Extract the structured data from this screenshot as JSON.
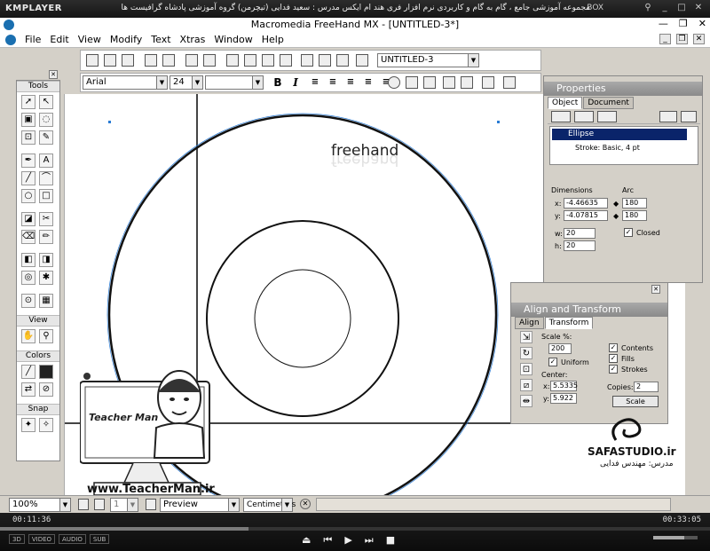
{
  "player": {
    "logo": "KMPLAYER",
    "title": "مجموعه آموزشی جامع ، گام به گام و کاربردی نرم افزار فری هند ام ایکس    مدرس : سعید فدایی (تیچرمن) گروه آموزشی پادشاه گرافیست ها",
    "box": "BOX",
    "time_elapsed": "00:11:36",
    "time_total": "00:33:05",
    "progress": 0.35,
    "volume": 0.7,
    "mini_buttons": [
      "3D",
      "VIDEO",
      "AUDIO",
      "SUB"
    ],
    "icons": [
      "pin-icon",
      "minimize-icon",
      "maximize-icon",
      "close-icon"
    ]
  },
  "app": {
    "title": "Macromedia FreeHand MX - [UNTITLED-3*]",
    "menus": [
      "File",
      "Edit",
      "View",
      "Modify",
      "Text",
      "Xtras",
      "Window",
      "Help"
    ],
    "document_dropdown": "UNTITLED-3",
    "font": "Arial",
    "font_size": "24"
  },
  "tools": {
    "title": "Tools",
    "view_title": "View",
    "colors_title": "Colors",
    "snap_title": "Snap"
  },
  "canvas": {
    "text": "freehand"
  },
  "properties": {
    "title": "Properties",
    "tabs": [
      "Object",
      "Document"
    ],
    "list": [
      "Ellipse",
      "Stroke: Basic, 4 pt"
    ],
    "dimensions_label": "Dimensions",
    "arc_label": "Arc",
    "x_label": "x:",
    "x_value": "-4.46635",
    "y_label": "y:",
    "y_value": "-4.07815",
    "w_label": "w:",
    "w_value": "20",
    "h_label": "h:",
    "h_value": "20",
    "arc_start": "180",
    "arc_end": "180",
    "closed_label": "Closed"
  },
  "align": {
    "title": "Align and Transform",
    "tabs": [
      "Align",
      "Transform"
    ],
    "scale_label": "Scale %:",
    "scale_value": "200",
    "uniform_label": "Uniform",
    "contents_label": "Contents",
    "fills_label": "Fills",
    "strokes_label": "Strokes",
    "center_label": "Center:",
    "cx_label": "x:",
    "cx_value": "5.5335",
    "cy_label": "y:",
    "cy_value": "5.922",
    "copies_label": "Copies:",
    "copies_value": "2",
    "scale_button": "Scale"
  },
  "watermarks": {
    "url": "www.TeacherMan.ir",
    "teacher": "Teacher Man",
    "safa": "SAFASTUDIO.ir",
    "safa_sub": "مدرس: مهندس فدایی"
  },
  "status": {
    "zoom": "100%",
    "page": "1",
    "preview": "Preview",
    "units": "Centimeters"
  }
}
